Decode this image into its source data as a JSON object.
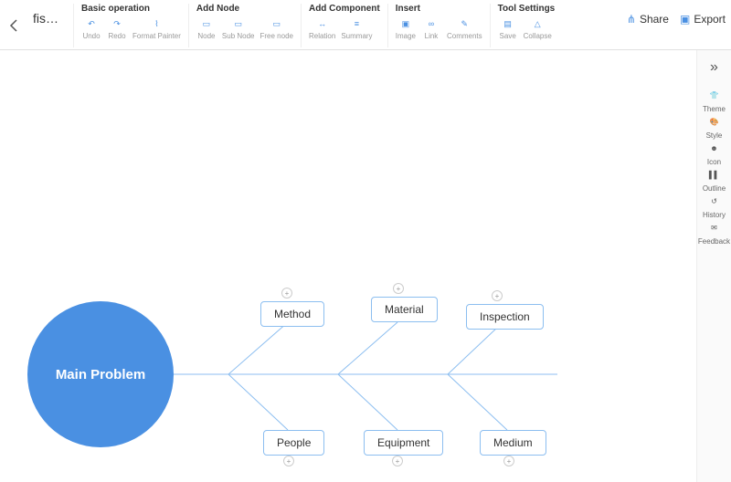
{
  "doc_name": "fis…",
  "toolbar": {
    "groups": [
      {
        "title": "Basic operation",
        "items": [
          {
            "id": "undo",
            "label": "Undo",
            "glyph": "↶"
          },
          {
            "id": "redo",
            "label": "Redo",
            "glyph": "↷"
          },
          {
            "id": "format-painter",
            "label": "Format Painter",
            "glyph": "⌇"
          }
        ]
      },
      {
        "title": "Add Node",
        "items": [
          {
            "id": "node",
            "label": "Node",
            "glyph": "▭"
          },
          {
            "id": "sub-node",
            "label": "Sub Node",
            "glyph": "▭"
          },
          {
            "id": "free-node",
            "label": "Free node",
            "glyph": "▭"
          }
        ]
      },
      {
        "title": "Add Component",
        "items": [
          {
            "id": "relation",
            "label": "Relation",
            "glyph": "↔"
          },
          {
            "id": "summary",
            "label": "Summary",
            "glyph": "≡"
          }
        ]
      },
      {
        "title": "Insert",
        "items": [
          {
            "id": "image",
            "label": "Image",
            "glyph": "▣"
          },
          {
            "id": "link",
            "label": "Link",
            "glyph": "∞"
          },
          {
            "id": "comments",
            "label": "Comments",
            "glyph": "✎"
          }
        ]
      },
      {
        "title": "Tool Settings",
        "items": [
          {
            "id": "save",
            "label": "Save",
            "glyph": "▤"
          },
          {
            "id": "collapse-tool",
            "label": "Collapse",
            "glyph": "△"
          }
        ]
      }
    ],
    "share": "Share",
    "export": "Export"
  },
  "sidebar": {
    "items": [
      {
        "id": "theme",
        "label": "Theme",
        "glyph": "👕"
      },
      {
        "id": "style",
        "label": "Style",
        "glyph": "🎨"
      },
      {
        "id": "icon",
        "label": "Icon",
        "glyph": "☻"
      },
      {
        "id": "outline",
        "label": "Outline",
        "glyph": "▌▌"
      },
      {
        "id": "history",
        "label": "History",
        "glyph": "↺"
      },
      {
        "id": "feedback",
        "label": "Feedback",
        "glyph": "✉"
      }
    ]
  },
  "diagram": {
    "head": "Main Problem",
    "top_causes": [
      "Method",
      "Material",
      "Inspection"
    ],
    "bottom_causes": [
      "People",
      "Equipment",
      "Medium"
    ]
  },
  "chart_data": {
    "type": "fishbone",
    "problem": "Main Problem",
    "categories": [
      {
        "name": "Method",
        "side": "top"
      },
      {
        "name": "Material",
        "side": "top"
      },
      {
        "name": "Inspection",
        "side": "top"
      },
      {
        "name": "People",
        "side": "bottom"
      },
      {
        "name": "Equipment",
        "side": "bottom"
      },
      {
        "name": "Medium",
        "side": "bottom"
      }
    ]
  }
}
